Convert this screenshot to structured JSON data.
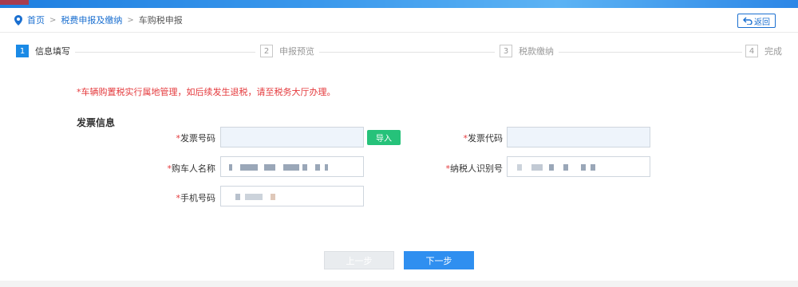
{
  "breadcrumb": {
    "home": "首页",
    "section": "税费申报及缴纳",
    "current": "车购税申报"
  },
  "back_label": "返回",
  "steps": [
    {
      "num": "1",
      "label": "信息填写",
      "active": true
    },
    {
      "num": "2",
      "label": "申报预览",
      "active": false
    },
    {
      "num": "3",
      "label": "税款缴纳",
      "active": false
    },
    {
      "num": "4",
      "label": "完成",
      "active": false
    }
  ],
  "notice": "*车辆购置税实行属地管理，如后续发生退税，请至税务大厅办理。",
  "section_title": "发票信息",
  "form": {
    "required_mark": "*",
    "invoice_number_label": "发票号码",
    "invoice_code_label": "发票代码",
    "buyer_name_label": "购车人名称",
    "taxpayer_id_label": "纳税人识别号",
    "phone_label": "手机号码",
    "import_label": "导入"
  },
  "buttons": {
    "prev": "上一步",
    "next": "下一步"
  },
  "colors": {
    "accent": "#1a8ae6",
    "required": "#e4393c",
    "import": "#26c27a",
    "next": "#2f8ff0"
  }
}
